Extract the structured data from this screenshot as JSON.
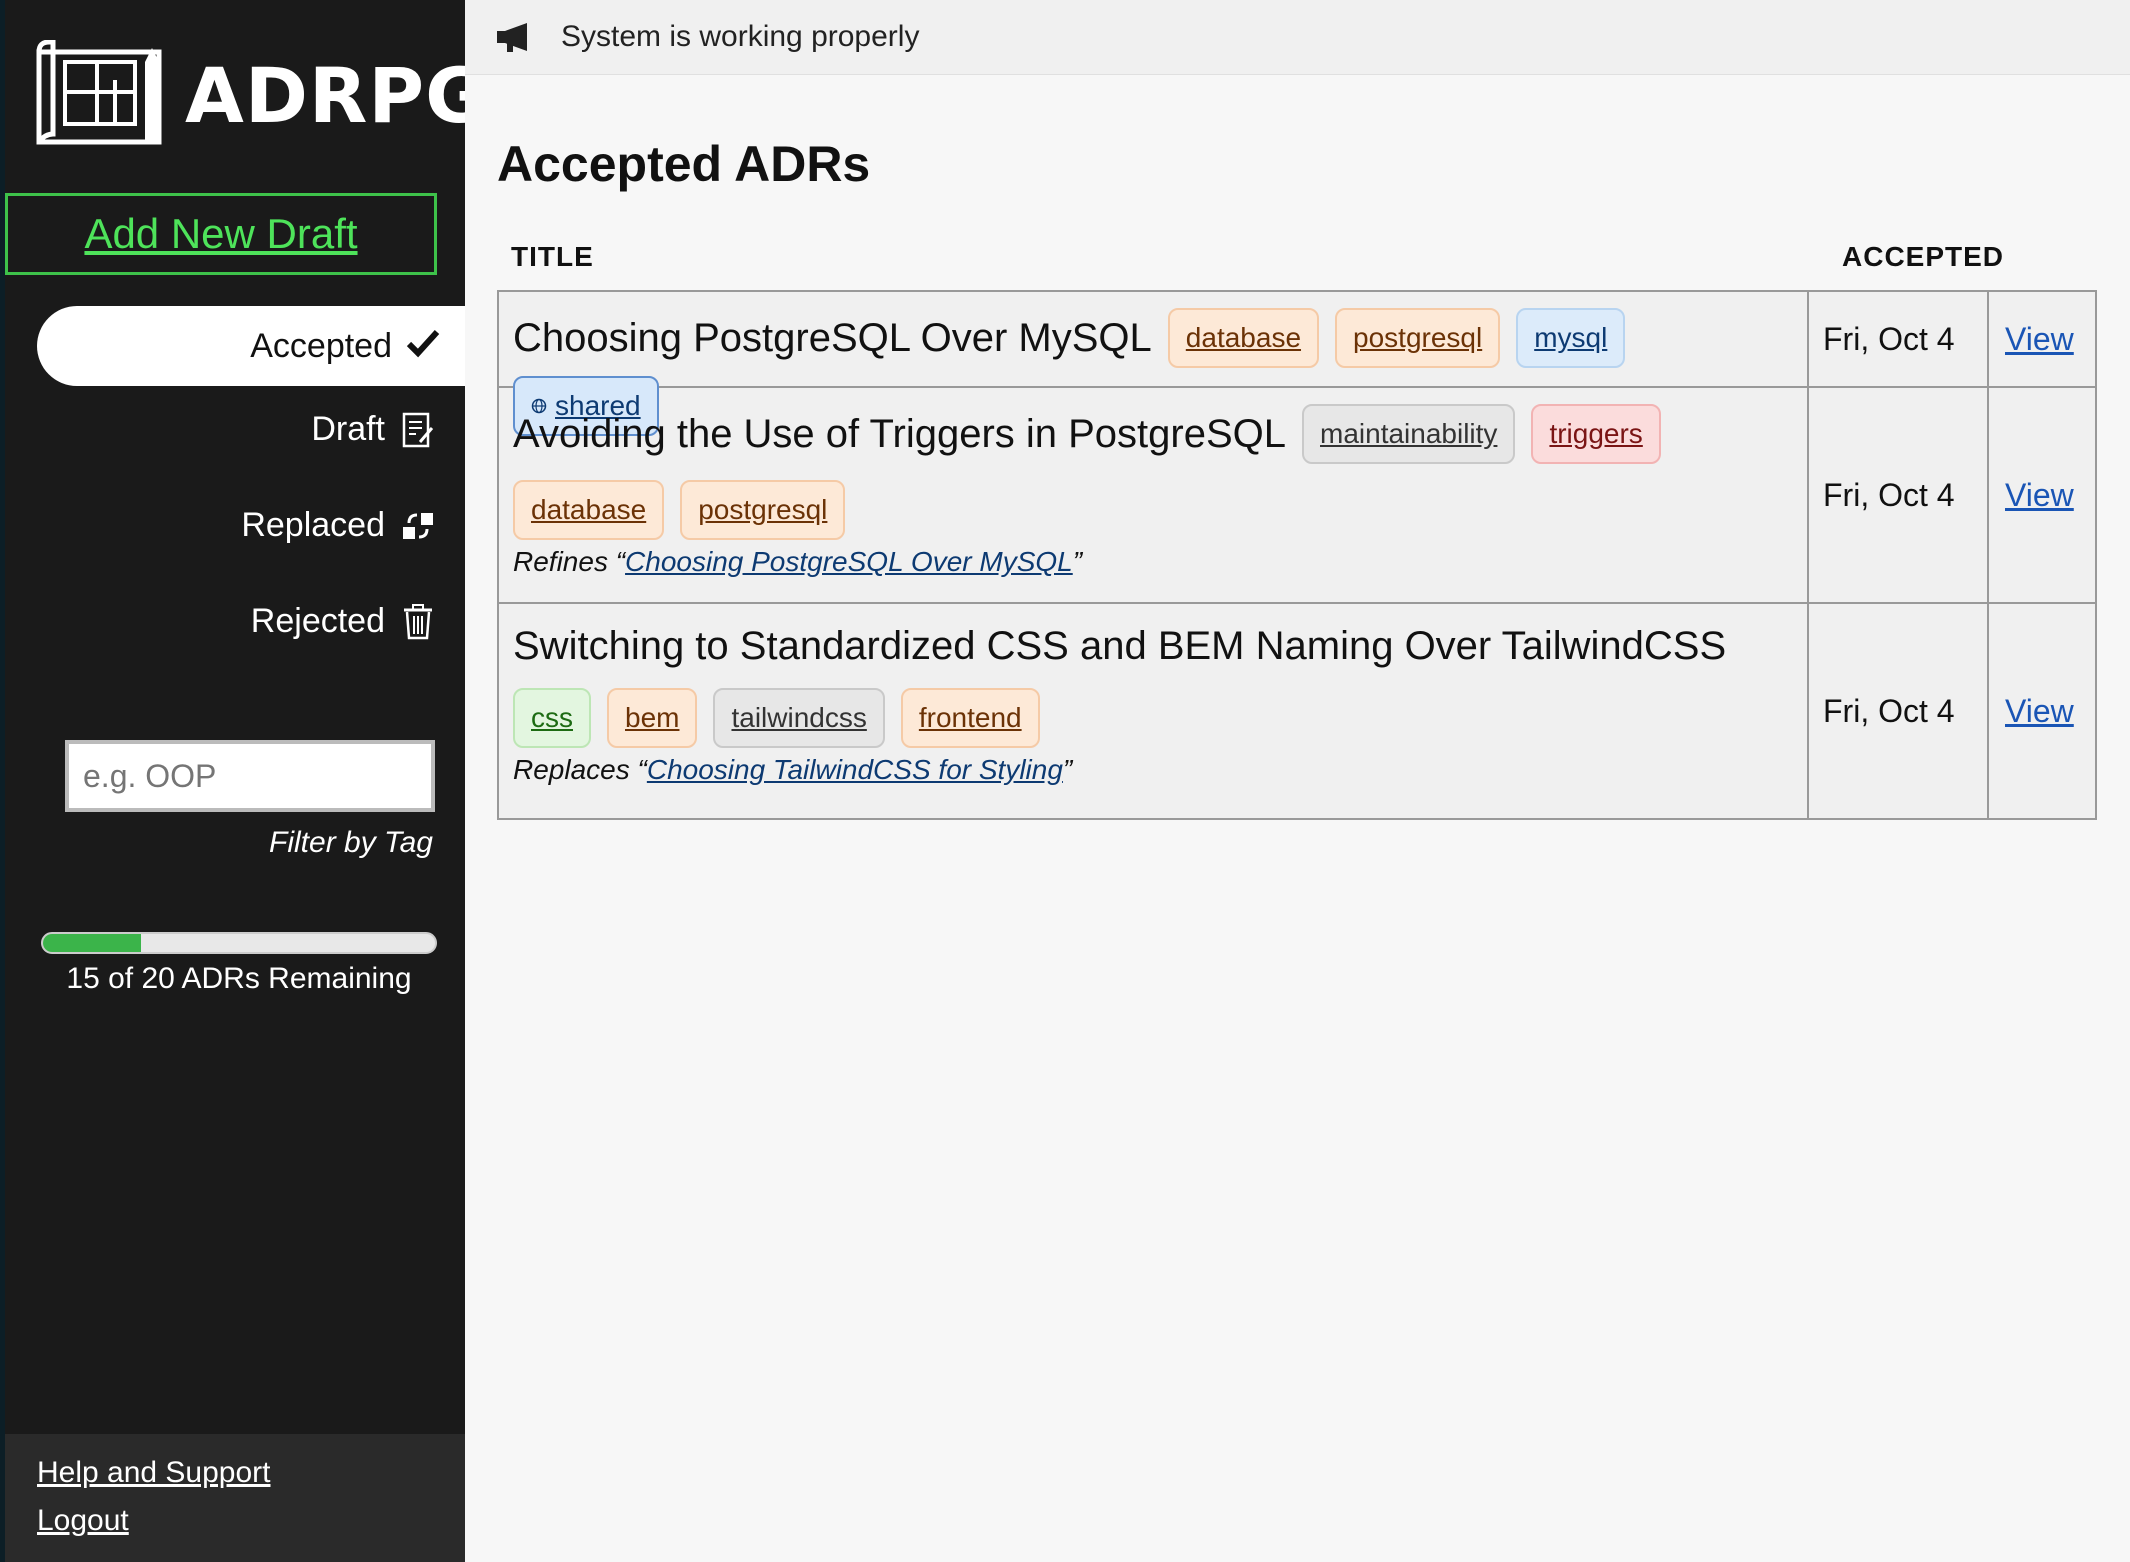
{
  "app": {
    "logo_text": "ADRPG"
  },
  "sidebar": {
    "add_draft_label": "Add New Draft",
    "nav": [
      {
        "label": "Accepted",
        "icon": "checkmark-icon",
        "active": true
      },
      {
        "label": "Draft",
        "icon": "draft-doc-icon"
      },
      {
        "label": "Replaced",
        "icon": "replace-icon"
      },
      {
        "label": "Rejected",
        "icon": "trash-icon"
      }
    ],
    "filter": {
      "placeholder": "e.g. OOP",
      "label": "Filter by Tag"
    },
    "progress": {
      "fraction": 0.25,
      "text": "15 of 20 ADRs Remaining"
    },
    "footer": {
      "help_label": "Help and Support",
      "logout_label": "Logout"
    }
  },
  "banner": {
    "icon": "megaphone-icon",
    "text": "System is working properly"
  },
  "main": {
    "heading": "Accepted ADRs",
    "columns": {
      "title": "TITLE",
      "accepted": "ACCEPTED"
    },
    "rows": [
      {
        "title": "Choosing PostgreSQL Over MySQL",
        "tags": [
          "database",
          "postgresql",
          "mysql",
          "shared"
        ],
        "date": "Fri, Oct 4",
        "view": "View"
      },
      {
        "title": "Avoiding the Use of Triggers in PostgreSQL",
        "tags": [
          "maintainability",
          "triggers",
          "database",
          "postgresql"
        ],
        "relation_prefix": "Refines “",
        "relation_link": "Choosing PostgreSQL Over MySQL",
        "relation_suffix": "”",
        "date": "Fri, Oct 4",
        "view": "View"
      },
      {
        "title": "Switching to Standardized CSS and BEM Naming Over TailwindCSS",
        "tags": [
          "css",
          "bem",
          "tailwindcss",
          "frontend"
        ],
        "relation_prefix": "Replaces “",
        "relation_link": "Choosing TailwindCSS for Styling",
        "relation_suffix": "”",
        "date": "Fri, Oct 4",
        "view": "View"
      }
    ]
  },
  "colors": {
    "sidebar_bg": "#1a1a1a",
    "accent_green": "#4ee35a",
    "link_blue": "#1a55b5"
  }
}
